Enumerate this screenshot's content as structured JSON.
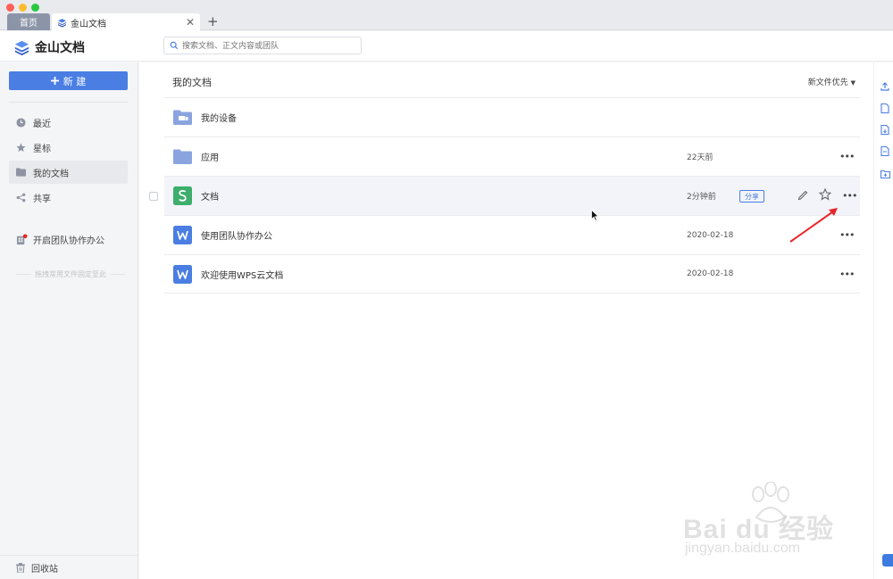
{
  "window": {
    "tabs": {
      "home": "首页",
      "active": "金山文档"
    },
    "tab_add": "+",
    "tab_close": "✕"
  },
  "header": {
    "logo_text": "金山文档",
    "search_placeholder": "搜索文档、正文内容或团队"
  },
  "sidebar": {
    "new_label": "新 建",
    "items": [
      {
        "label": "最近",
        "icon": "clock-icon"
      },
      {
        "label": "星标",
        "icon": "star-icon"
      },
      {
        "label": "我的文档",
        "icon": "folder-icon",
        "active": true
      },
      {
        "label": "共享",
        "icon": "share-icon"
      }
    ],
    "team_label": "开启团队协作办公",
    "hint": "拖拽常用文件固定至此",
    "recycle_label": "回收站"
  },
  "main": {
    "title": "我的文档",
    "sort_label": "新文件优先",
    "files": [
      {
        "name": "我的设备",
        "type": "device-folder",
        "date": ""
      },
      {
        "name": "应用",
        "type": "folder",
        "date": "22天前"
      },
      {
        "name": "文档",
        "type": "sheet",
        "date": "2分钟前",
        "shared": "分享",
        "hover": true
      },
      {
        "name": "使用团队协作办公",
        "type": "doc",
        "date": "2020-02-18"
      },
      {
        "name": "欢迎使用WPS云文档",
        "type": "doc",
        "date": "2020-02-18"
      }
    ],
    "more_glyph": "•••"
  },
  "watermark": {
    "brand": "Bai du 经验",
    "url": "jingyan.baidu.com"
  },
  "colors": {
    "accent": "#4a7ee3",
    "folder": "#8aa4e0",
    "sheet": "#3dae6b",
    "doc": "#4a7ee3",
    "annotation": "#e8262a"
  }
}
